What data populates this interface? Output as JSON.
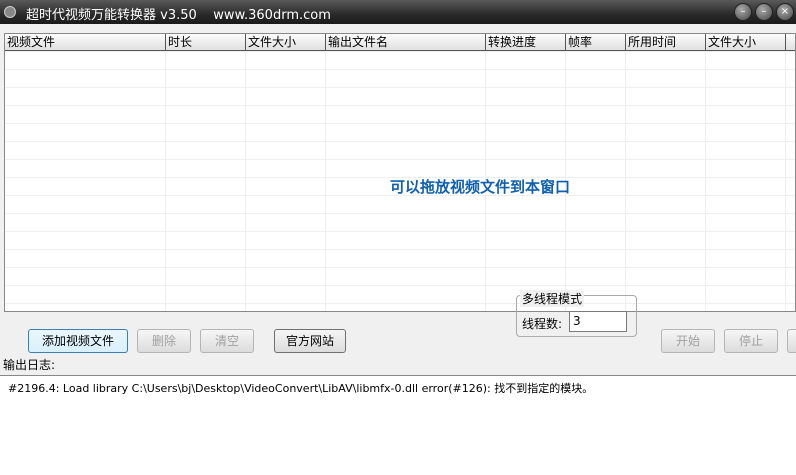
{
  "window": {
    "title": "超时代视频万能转换器 v3.50    www.360drm.com",
    "buttons": [
      "–",
      "–",
      "×"
    ]
  },
  "columns": [
    "视频文件",
    "时长",
    "文件大小",
    "输出文件名",
    "转换进度",
    "帧率",
    "所用时间",
    "文件大小",
    ""
  ],
  "drop_hint": "可以拖放视频文件到本窗口",
  "buttons": {
    "add": "添加视频文件",
    "delete": "删除",
    "clear": "清空",
    "website": "官方网站",
    "start": "开始",
    "stop": "停止"
  },
  "thread": {
    "group_label": "多线程模式",
    "label": "线程数:",
    "value": "3"
  },
  "log": {
    "label": "输出日志:",
    "lines": [
      "#2196.4: Load library C:\\Users\\bj\\Desktop\\VideoConvert\\LibAV\\libmfx-0.dll error(#126): 找不到指定的模块。"
    ]
  }
}
